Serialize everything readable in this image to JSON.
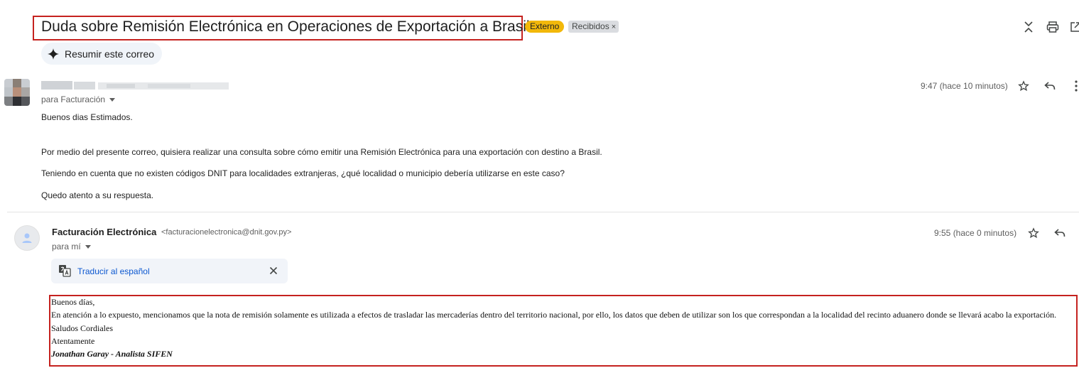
{
  "subject": "Duda sobre Remisión Electrónica en Operaciones de Exportación a Brasil",
  "labels": {
    "externo": "Externo",
    "recibidos": "Recibidos",
    "remove_symbol": "×"
  },
  "icons": {
    "collapse": "unfold-less-icon",
    "print": "print-icon",
    "open_new_window": "open-in-new-icon",
    "sparkle": "sparkle-icon",
    "star": "star-icon",
    "reply": "reply-icon",
    "more": "more-vertical-icon",
    "translate": "translate-icon",
    "close": "close-icon",
    "person": "person-icon"
  },
  "summarize": {
    "label": "Resumir este correo"
  },
  "messages": [
    {
      "to": "para Facturación",
      "time": "9:47 (hace 10 minutos)",
      "body": [
        "Buenos dias Estimados.",
        "Por medio del presente correo, quisiera realizar una consulta sobre cómo emitir una Remisión Electrónica para una exportación con destino a Brasil.",
        "Teniendo en cuenta que no existen códigos DNIT para localidades extranjeras, ¿qué localidad o municipio debería utilizarse en este caso?",
        "Quedo atento a su respuesta."
      ]
    },
    {
      "sender_name": "Facturación Electrónica",
      "sender_email": "<facturacionelectronica@dnit.gov.py>",
      "to": "para mí",
      "time": "9:55 (hace 0 minutos)",
      "translate_label": "Traducir al español",
      "body": [
        "Buenos días,",
        "En atención a lo expuesto, mencionamos que la nota de remisión solamente es utilizada a efectos de trasladar las mercaderías dentro del territorio nacional, por ello, los datos que deben de utilizar son los que correspondan a la localidad del recinto aduanero donde se llevará acabo la exportación.",
        "Saludos Cordiales",
        "Atentamente",
        "Jonathan Garay - Analista SIFEN"
      ]
    }
  ],
  "colors": {
    "highlight_border": "#c5221f",
    "label_externo": "#f2b80a",
    "label_recibidos": "#dadce0",
    "link": "#0b57d0"
  }
}
